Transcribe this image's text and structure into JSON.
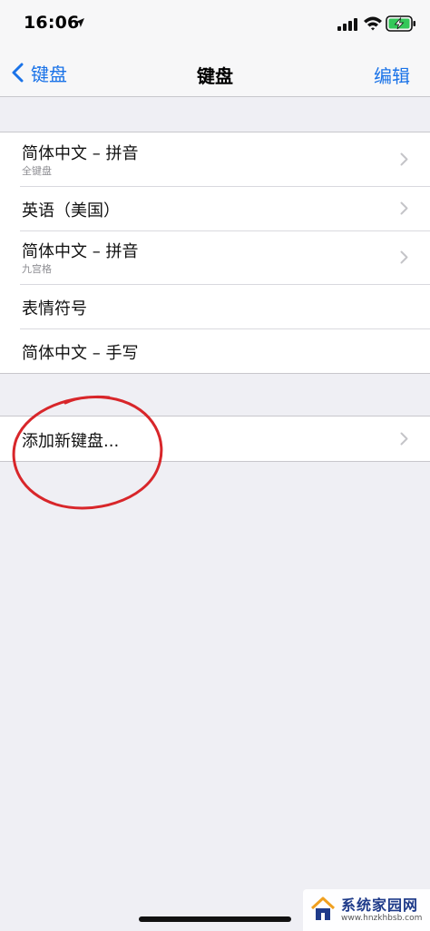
{
  "status_bar": {
    "time": "16:06"
  },
  "nav": {
    "back_label": "键盘",
    "title": "键盘",
    "edit_label": "编辑"
  },
  "keyboards": [
    {
      "title": "简体中文 – 拼音",
      "subtitle": "全键盘",
      "has_chevron": true
    },
    {
      "title": "英语（美国）",
      "has_chevron": true
    },
    {
      "title": "简体中文 – 拼音",
      "subtitle": "九宫格",
      "has_chevron": true
    },
    {
      "title": "表情符号",
      "has_chevron": false
    },
    {
      "title": "简体中文 – 手写",
      "has_chevron": false
    }
  ],
  "add_keyboard": {
    "label": "添加新键盘..."
  },
  "watermark": {
    "title": "系统家园网",
    "url": "www.hnzkhbsb.com"
  },
  "colors": {
    "accent": "#1a73e8",
    "background": "#efeff4",
    "annotation": "#d8262a",
    "battery": "#34c759"
  }
}
